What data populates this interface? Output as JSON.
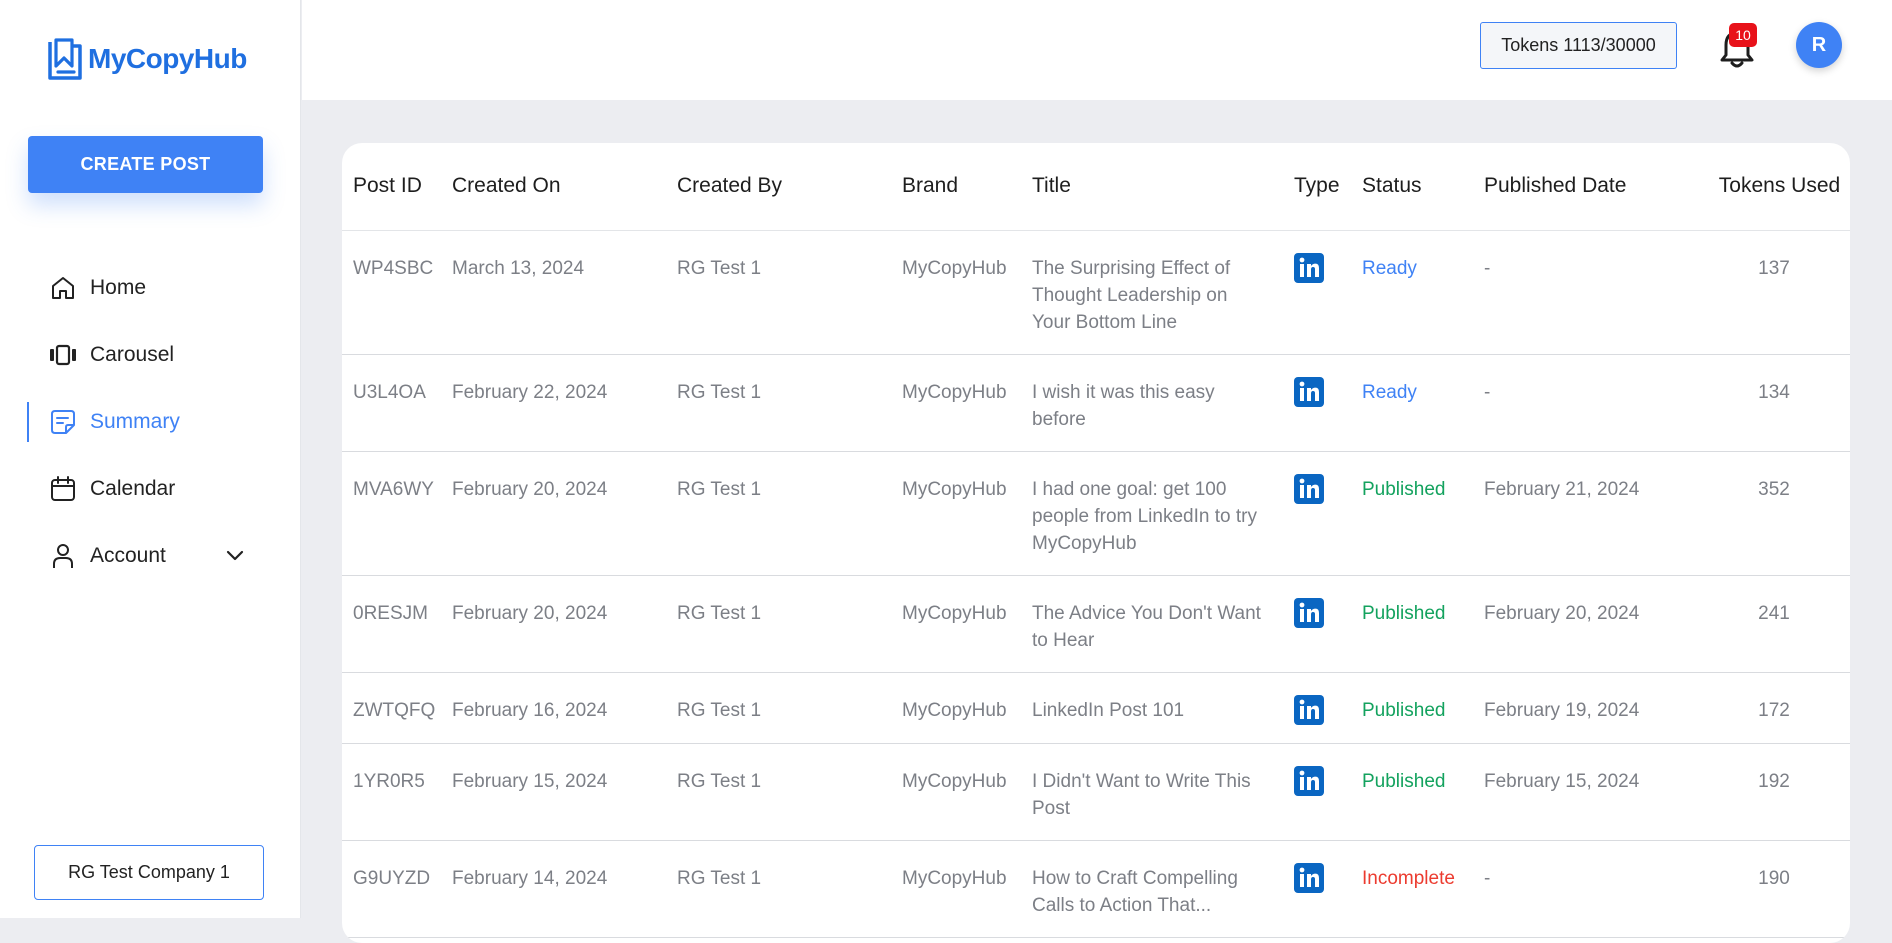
{
  "sidebar": {
    "brand": "MyCopyHub",
    "create_post_label": "CREATE POST",
    "items": [
      {
        "label": "Home",
        "icon": "home-icon"
      },
      {
        "label": "Carousel",
        "icon": "carousel-icon"
      },
      {
        "label": "Summary",
        "icon": "summary-icon",
        "active": true
      },
      {
        "label": "Calendar",
        "icon": "calendar-icon"
      },
      {
        "label": "Account",
        "icon": "user-icon"
      }
    ],
    "company_label": "RG Test Company 1"
  },
  "header": {
    "tokens_label": "Tokens 1113/30000",
    "notification_count": "10",
    "avatar_initial": "R"
  },
  "colors": {
    "accent": "#3f82f5",
    "published": "#13a25e",
    "incomplete": "#ec3b2f",
    "linkedin": "#0a66c2"
  },
  "table": {
    "columns": [
      "Post ID",
      "Created On",
      "Created By",
      "Brand",
      "Title",
      "Type",
      "Status",
      "Published Date",
      "Tokens Used"
    ],
    "rows": [
      {
        "id": "WP4SBC",
        "created_on": "March 13, 2024",
        "created_by": "RG Test 1",
        "brand": "MyCopyHub",
        "title": "The Surprising Effect of Thought Leadership on Your Bottom Line",
        "type": "linkedin-icon",
        "status": "Ready",
        "published": "-",
        "tokens": "137"
      },
      {
        "id": "U3L4OA",
        "created_on": "February 22, 2024",
        "created_by": "RG Test 1",
        "brand": "MyCopyHub",
        "title": "I wish it was this easy before",
        "type": "linkedin-icon",
        "status": "Ready",
        "published": "-",
        "tokens": "134"
      },
      {
        "id": "MVA6WY",
        "created_on": "February 20, 2024",
        "created_by": "RG Test 1",
        "brand": "MyCopyHub",
        "title": "I had one goal: get 100 people from LinkedIn to try MyCopyHub",
        "type": "linkedin-icon",
        "status": "Published",
        "published": "February 21, 2024",
        "tokens": "352"
      },
      {
        "id": "0RESJM",
        "created_on": "February 20, 2024",
        "created_by": "RG Test 1",
        "brand": "MyCopyHub",
        "title": "The Advice You Don't Want to Hear",
        "type": "linkedin-icon",
        "status": "Published",
        "published": "February 20, 2024",
        "tokens": "241"
      },
      {
        "id": "ZWTQFQ",
        "created_on": "February 16, 2024",
        "created_by": "RG Test 1",
        "brand": "MyCopyHub",
        "title": "LinkedIn Post 101",
        "type": "linkedin-icon",
        "status": "Published",
        "published": "February 19, 2024",
        "tokens": "172"
      },
      {
        "id": "1YR0R5",
        "created_on": "February 15, 2024",
        "created_by": "RG Test 1",
        "brand": "MyCopyHub",
        "title": "I Didn't Want to Write This Post",
        "type": "linkedin-icon",
        "status": "Published",
        "published": "February 15, 2024",
        "tokens": "192"
      },
      {
        "id": "G9UYZD",
        "created_on": "February 14, 2024",
        "created_by": "RG Test 1",
        "brand": "MyCopyHub",
        "title": "How to Craft Compelling Calls to Action That...",
        "type": "linkedin-icon",
        "status": "Incomplete",
        "published": "-",
        "tokens": "190"
      }
    ]
  }
}
